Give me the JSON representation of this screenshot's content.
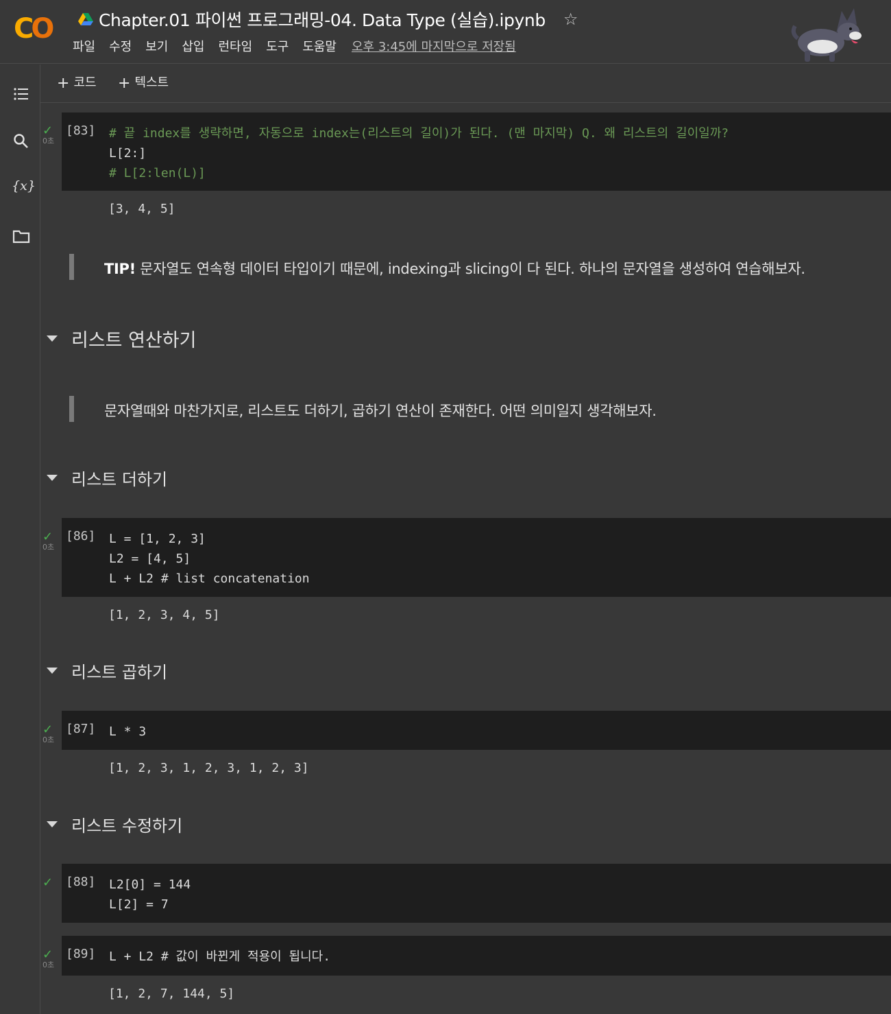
{
  "app": {
    "logo_text_c": "C",
    "logo_text_o": "O"
  },
  "header": {
    "title": "Chapter.01 파이썬 프로그래밍-04. Data Type (실습).ipynb",
    "star_glyph": "☆",
    "menu": [
      "파일",
      "수정",
      "보기",
      "삽입",
      "런타임",
      "도구",
      "도움말"
    ],
    "saved_status": "오후 3:45에 마지막으로 저장됨"
  },
  "toolbar": {
    "add_code": "코드",
    "add_text": "텍스트",
    "plus": "+"
  },
  "cells": [
    {
      "type": "code",
      "prompt": "[83]",
      "status": "✓",
      "time": "0초",
      "lines": [
        "# 끝 index를 생략하면, 자동으로 index는(리스트의 길이)가 된다. (맨 마지막) Q. 왜 리스트의 길이일까?",
        "L[2:]",
        "# L[2:len(L)]"
      ],
      "output": "[3, 4, 5]"
    },
    {
      "type": "quote",
      "bold": "TIP!",
      "text": " 문자열도 연속형 데이터 타입이기 때문에, indexing과 slicing이 다 된다. 하나의 문자열을 생성하여 연습해보자."
    },
    {
      "type": "heading",
      "text": "리스트 연산하기"
    },
    {
      "type": "quote",
      "text": "문자열때와 마찬가지로, 리스트도 더하기, 곱하기 연산이 존재한다. 어떤 의미일지 생각해보자."
    },
    {
      "type": "heading",
      "text": "리스트 더하기"
    },
    {
      "type": "code",
      "prompt": "[86]",
      "status": "✓",
      "time": "0초",
      "lines": [
        "L = [1, 2, 3]",
        "L2 = [4, 5]",
        "L + L2 # list concatenation"
      ],
      "output": "[1, 2, 3, 4, 5]"
    },
    {
      "type": "heading",
      "text": "리스트 곱하기"
    },
    {
      "type": "code",
      "prompt": "[87]",
      "status": "✓",
      "time": "0초",
      "lines": [
        "L * 3"
      ],
      "output": "[1, 2, 3, 1, 2, 3, 1, 2, 3]"
    },
    {
      "type": "heading",
      "text": "리스트 수정하기"
    },
    {
      "type": "code",
      "prompt": "[88]",
      "status": "✓",
      "lines": [
        "L2[0] = 144",
        "L[2] = 7"
      ]
    },
    {
      "type": "code",
      "prompt": "[89]",
      "status": "✓",
      "time": "0초",
      "lines": [
        "L + L2 # 값이 바뀐게 적용이 됩니다."
      ],
      "output": "[1, 2, 7, 144, 5]"
    }
  ],
  "colors": {
    "background": "#383838",
    "code_background": "#1e1e1e",
    "comment": "#6a9955",
    "number": "#b5cea8",
    "check": "#4caf50",
    "logo_yellow": "#f9ab00",
    "logo_orange": "#e8710a"
  },
  "icons": [
    "drive-icon",
    "star-icon",
    "toc-icon",
    "search-icon",
    "variables-icon",
    "folder-icon",
    "caret-down-icon",
    "check-icon"
  ]
}
